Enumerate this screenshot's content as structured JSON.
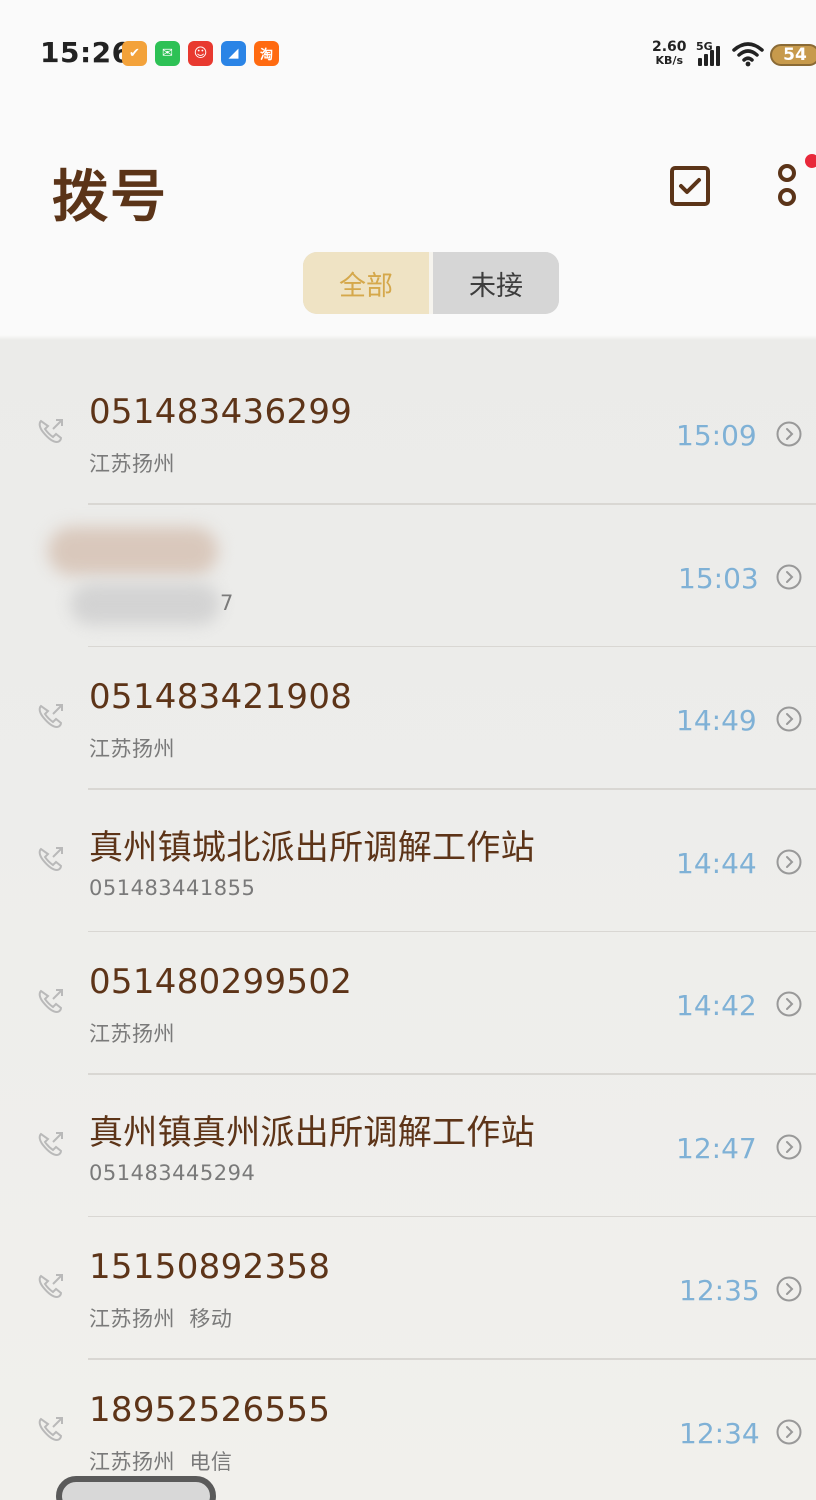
{
  "status_bar": {
    "time": "15:26",
    "notifications": [
      {
        "icon": "app-orange-icon",
        "color": "#f3a23a",
        "glyph": "✔"
      },
      {
        "icon": "wechat-icon",
        "color": "#2dc155",
        "glyph": "✉"
      },
      {
        "icon": "app-red-mascot-icon",
        "color": "#e8392f",
        "glyph": "☺"
      },
      {
        "icon": "app-blue-icon",
        "color": "#2a84e6",
        "glyph": "◢"
      },
      {
        "icon": "taobao-icon",
        "color": "#ff6a10",
        "glyph": "淘"
      }
    ],
    "net_speed": "2.60",
    "net_unit": "KB/s",
    "network_type": "5G",
    "battery": "54"
  },
  "header": {
    "title": "拨号"
  },
  "tabs": [
    {
      "label": "全部",
      "active": true
    },
    {
      "label": "未接",
      "active": false
    }
  ],
  "calls": [
    {
      "name": "051483436299",
      "sub": "江苏扬州",
      "time": "15:09"
    },
    {
      "name": "",
      "sub": "7",
      "time": "15:03"
    },
    {
      "name": "051483421908",
      "sub": "江苏扬州",
      "time": "14:49"
    },
    {
      "name": "真州镇城北派出所调解工作站",
      "sub": "051483441855",
      "time": "14:44"
    },
    {
      "name": "051480299502",
      "sub": "江苏扬州",
      "time": "14:42"
    },
    {
      "name": "真州镇真州派出所调解工作站",
      "sub": "051483445294",
      "time": "12:47"
    },
    {
      "name": "15150892358",
      "sub": "江苏扬州  移动",
      "time": "12:35"
    },
    {
      "name": "18952526555",
      "sub": "江苏扬州  电信",
      "time": "12:34"
    }
  ],
  "colors": {
    "title": "#5b3418",
    "time": "#7fb1d6",
    "tab_active_bg": "#efe3c4",
    "tab_active_text": "#d5a84b"
  }
}
